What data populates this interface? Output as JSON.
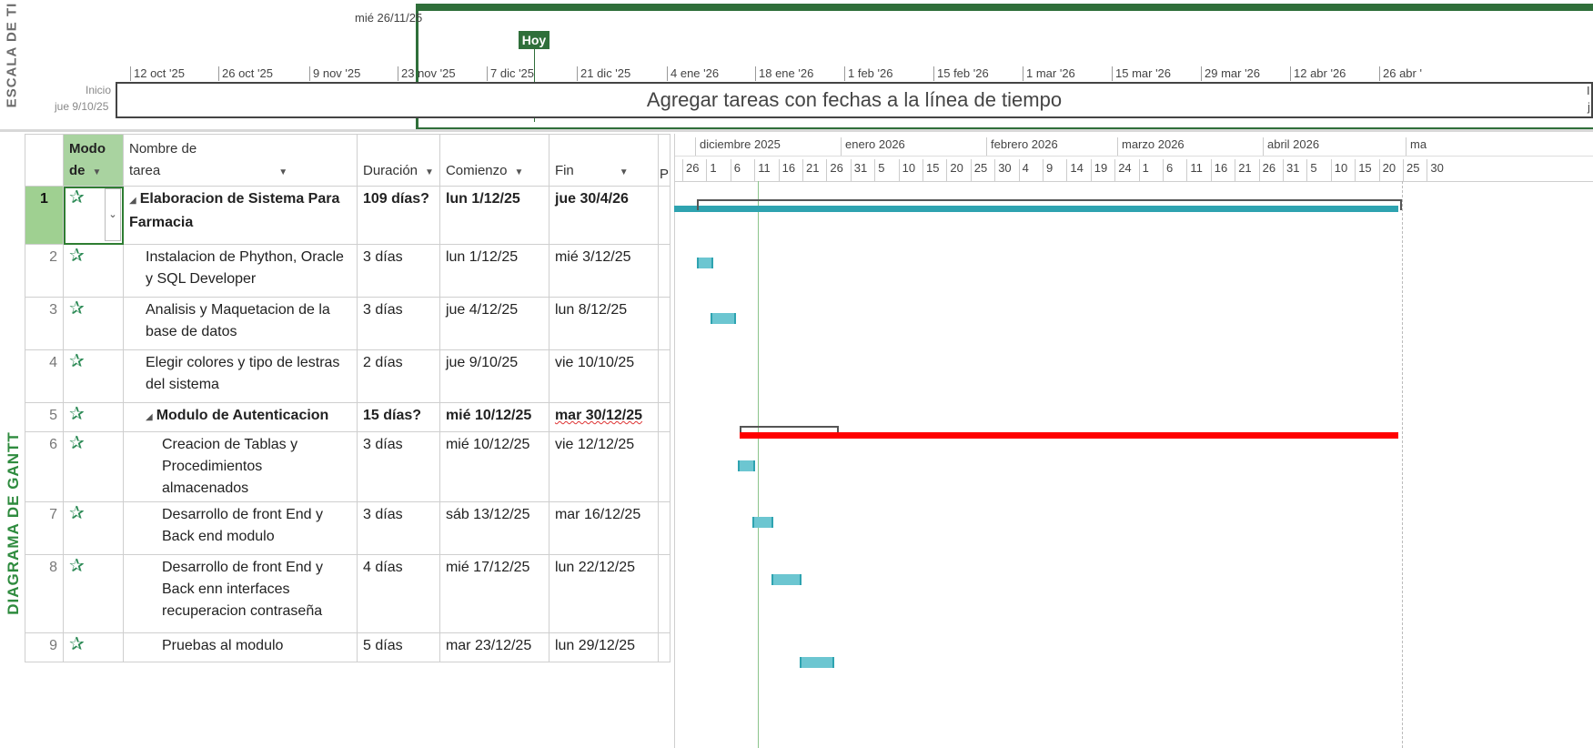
{
  "sidebar": {
    "scale_label": "ESCALA DE TI",
    "gantt_label": "DIAGRAMA DE GANTT"
  },
  "timeline": {
    "top_date": "mié 26/11/25",
    "today_label": "Hoy",
    "start_label": "Inicio",
    "start_date": "jue 9/10/25",
    "prompt": "Agregar tareas con fechas a la línea de tiempo",
    "end_partial_1": "I",
    "end_partial_2": "j",
    "ticks": [
      "12 oct '25",
      "26 oct '25",
      "9 nov '25",
      "23 nov '25",
      "7 dic '25",
      "21 dic '25",
      "4 ene '26",
      "18 ene '26",
      "1 feb '26",
      "15 feb '26",
      "1 mar '26",
      "15 mar '26",
      "29 mar '26",
      "12 abr '26",
      "26 abr '"
    ]
  },
  "grid": {
    "headers": {
      "modo": "Modo de",
      "name": "Nombre de tarea",
      "duration": "Duración",
      "start": "Comienzo",
      "finish": "Fin",
      "pred": "P"
    },
    "rows": [
      {
        "id": "1",
        "name": "Elaboracion de Sistema  Para Farmacia",
        "duration": "109 días?",
        "start": "lun 1/12/25",
        "finish": "jue 30/4/26"
      },
      {
        "id": "2",
        "name": "Instalacion  de  Phython, Oracle y SQL Developer",
        "duration": "3 días",
        "start": "lun 1/12/25",
        "finish": "mié 3/12/25"
      },
      {
        "id": "3",
        "name": "Analisis y Maquetacion de  la base de datos",
        "duration": "3 días",
        "start": "jue 4/12/25",
        "finish": "lun 8/12/25"
      },
      {
        "id": "4",
        "name": "Elegir colores y tipo de lestras del sistema",
        "duration": "2 días",
        "start": "jue 9/10/25",
        "finish": "vie 10/10/25"
      },
      {
        "id": "5",
        "name": "Modulo de  Autenticacion",
        "duration": "15 días?",
        "start": "mié 10/12/25",
        "finish": "mar 30/12/25"
      },
      {
        "id": "6",
        "name": "Creacion de Tablas  y Procedimientos almacenados",
        "duration": "3 días",
        "start": "mié 10/12/25",
        "finish": "vie 12/12/25"
      },
      {
        "id": "7",
        "name": "Desarrollo de front End y Back end modulo",
        "duration": "3 días",
        "start": "sáb 13/12/25",
        "finish": "mar 16/12/25"
      },
      {
        "id": "8",
        "name": "Desarrollo de front End y Back enn interfaces recuperacion contraseña",
        "duration": "4 días",
        "start": "mié 17/12/25",
        "finish": "lun 22/12/25"
      },
      {
        "id": "9",
        "name": "Pruebas al modulo",
        "duration": "5 días",
        "start": "mar 23/12/25",
        "finish": "lun 29/12/25"
      }
    ]
  },
  "chart": {
    "months": [
      "diciembre 2025",
      "enero 2026",
      "febrero 2026",
      "marzo 2026",
      "abril 2026",
      "ma"
    ],
    "days": [
      "26",
      "1",
      "6",
      "11",
      "16",
      "21",
      "26",
      "31",
      "5",
      "10",
      "15",
      "20",
      "25",
      "30",
      "4",
      "9",
      "14",
      "19",
      "24",
      "1",
      "6",
      "11",
      "16",
      "21",
      "26",
      "31",
      "5",
      "10",
      "15",
      "20",
      "25",
      "30"
    ]
  },
  "colors": {
    "task_bar": "#6cc6d1",
    "summary_bar": "#2ea3b0",
    "critical_bar": "#ff0000",
    "accent_green": "#2f6f3a"
  }
}
